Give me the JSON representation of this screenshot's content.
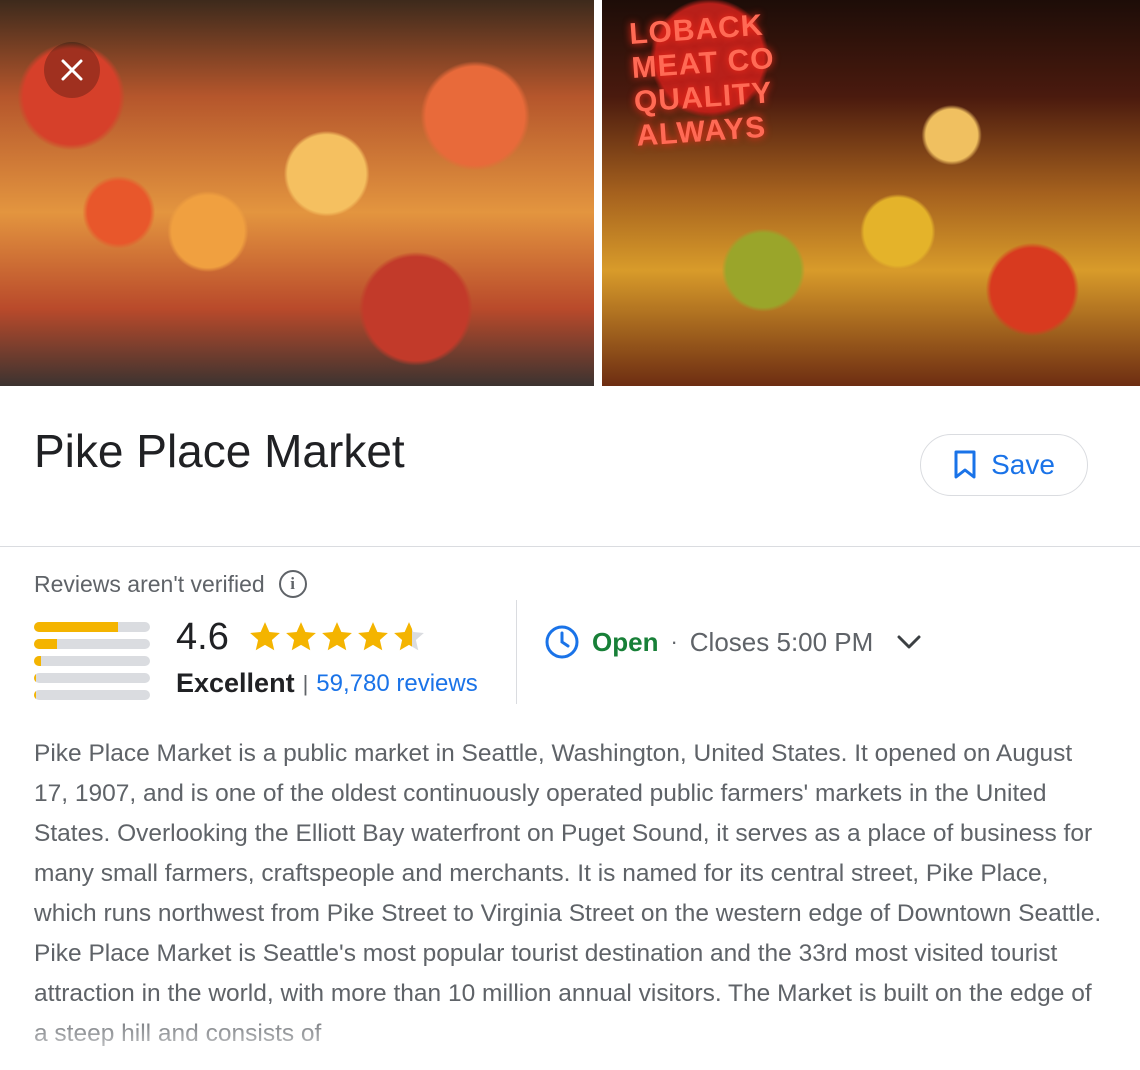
{
  "photos": {
    "left": {
      "icon": "market-produce-photo"
    },
    "right": {
      "icon": "market-stall-photo",
      "sign_text": "LOBACK MEAT CO QUALITY ALWAYS"
    }
  },
  "place": {
    "title": "Pike Place Market",
    "save_label": "Save"
  },
  "reviews": {
    "note": "Reviews aren't verified",
    "rating": "4.6",
    "rating_word": "Excellent",
    "separator": "|",
    "review_count": "59,780 reviews",
    "stars_value": 4.6,
    "distribution": [
      0.72,
      0.2,
      0.06,
      0.02,
      0.02
    ]
  },
  "hours": {
    "status": "Open",
    "dot": "·",
    "closes": "Closes 5:00 PM"
  },
  "description": "Pike Place Market is a public market in Seattle, Washington, United States. It opened on August 17, 1907, and is one of the oldest continuously operated public farmers' markets in the United States. Overlooking the Elliott Bay waterfront on Puget Sound, it serves as a place of business for many small farmers, craftspeople and merchants. It is named for its central street, Pike Place, which runs northwest from Pike Street to Virginia Street on the western edge of Downtown Seattle. Pike Place Market is Seattle's most popular tourist destination and the 33rd most visited tourist attraction in the world, with more than 10 million annual visitors. The Market is built on the edge of a steep hill and consists of",
  "colors": {
    "accent": "#1a73e8",
    "open_green": "#188038",
    "star": "#f4b400"
  }
}
